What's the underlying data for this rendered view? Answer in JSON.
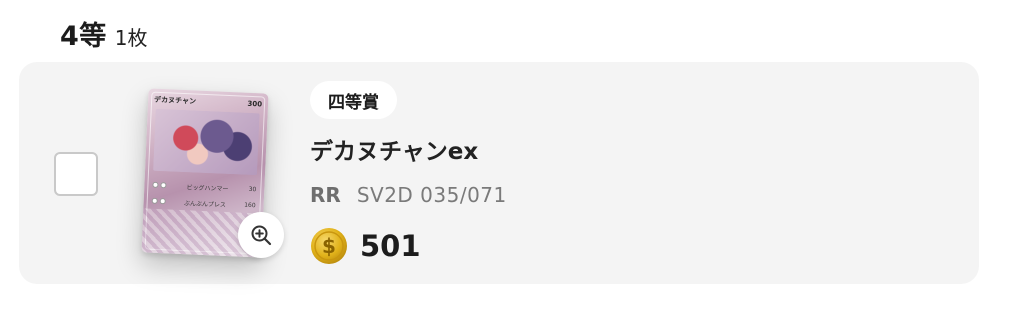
{
  "section": {
    "tier": "4等",
    "count": "1枚"
  },
  "item": {
    "selected": false,
    "badge": "四等賞",
    "card_name": "デカヌチャンex",
    "rarity": "RR",
    "set_code": "SV2D 035/071",
    "price": "501",
    "icons": {
      "zoom": "zoom-in-icon",
      "coin": "coin-icon"
    }
  },
  "card_image": {
    "name": "デカヌチャン",
    "hp": "300",
    "attack_1": "ビッグハンマー",
    "attack_1_damage": "30",
    "attack_2": "ぶんぶんプレス",
    "attack_2_damage": "160"
  },
  "colors": {
    "panel_bg": "#f4f4f4",
    "coin_gold": "#e1b21a",
    "text_dark": "#1c1c1c",
    "text_muted": "#7a7a7a"
  }
}
